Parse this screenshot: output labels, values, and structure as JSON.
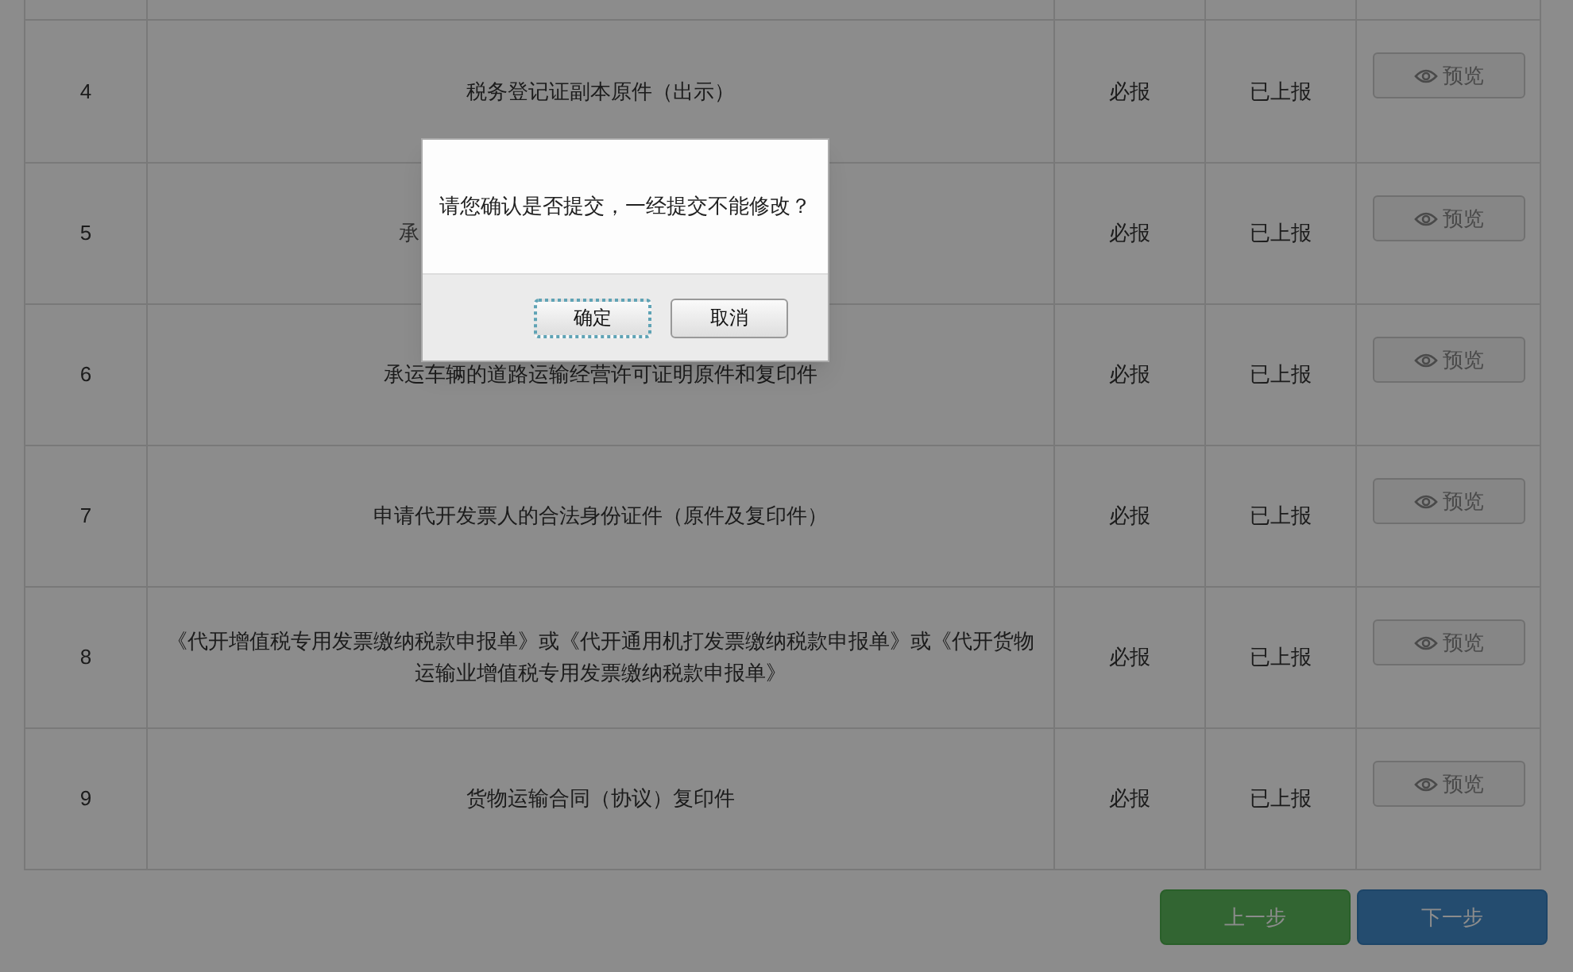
{
  "table": {
    "rows": [
      {
        "index": "4",
        "name": "税务登记证副本原件（出示）",
        "covered": false,
        "required": "必报",
        "status": "已上报",
        "action": "预览"
      },
      {
        "index": "5",
        "name": "承",
        "covered": true,
        "required": "必报",
        "status": "已上报",
        "action": "预览"
      },
      {
        "index": "6",
        "name": "承运车辆的道路运输经营许可证明原件和复印件",
        "covered": false,
        "required": "必报",
        "status": "已上报",
        "action": "预览"
      },
      {
        "index": "7",
        "name": "申请代开发票人的合法身份证件（原件及复印件）",
        "covered": false,
        "required": "必报",
        "status": "已上报",
        "action": "预览"
      },
      {
        "index": "8",
        "name": "《代开增值税专用发票缴纳税款申报单》或《代开通用机打发票缴纳税款申报单》或《代开货物运输业增值税专用发票缴纳税款申报单》",
        "covered": false,
        "required": "必报",
        "status": "已上报",
        "action": "预览"
      },
      {
        "index": "9",
        "name": "货物运输合同（协议）复印件",
        "covered": false,
        "required": "必报",
        "status": "已上报",
        "action": "预览"
      }
    ]
  },
  "nav_buttons": [
    {
      "label": "上一步",
      "kind": "prev"
    },
    {
      "label": "下一步",
      "kind": "next"
    }
  ],
  "dialog": {
    "message": "请您确认是否提交，一经提交不能修改？",
    "buttons": [
      {
        "label": "确定",
        "focused": true
      },
      {
        "label": "取消",
        "focused": false
      }
    ]
  }
}
